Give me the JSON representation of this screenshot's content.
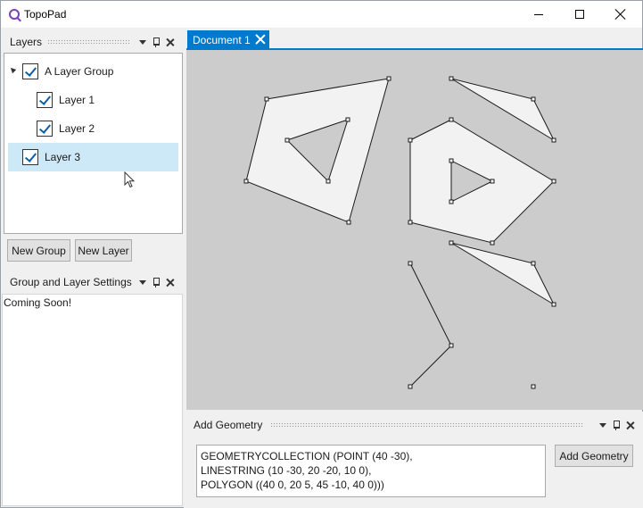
{
  "window": {
    "title": "TopoPad",
    "controls": [
      "minimize",
      "maximize",
      "close"
    ]
  },
  "layers_panel": {
    "title": "Layers",
    "tree": [
      {
        "label": "A Layer Group",
        "checked": true,
        "expanded": true,
        "level": 0
      },
      {
        "label": "Layer 1",
        "checked": true,
        "level": 1
      },
      {
        "label": "Layer 2",
        "checked": true,
        "level": 1
      },
      {
        "label": "Layer 3",
        "checked": true,
        "level": 0,
        "selected": true
      }
    ],
    "new_group_label": "New Group",
    "new_layer_label": "New Layer"
  },
  "settings_panel": {
    "title": "Group and Layer Settings",
    "content": "Coming Soon!"
  },
  "document": {
    "tab_label": "Document 1",
    "canvas_color": "#cccccc",
    "fill_color": "#f2f2f2"
  },
  "add_geometry_panel": {
    "title": "Add Geometry",
    "wkt_lines": [
      "GEOMETRYCOLLECTION (POINT (40 -30),",
      "LINESTRING (10 -30, 20 -20, 10 0),",
      "POLYGON ((40 0, 20 5, 45 -10, 40 0)))"
    ],
    "button_label": "Add Geometry"
  },
  "colors": {
    "accent": "#007acc",
    "selection": "#cde8f6",
    "app_icon": "#7b3fb8"
  }
}
